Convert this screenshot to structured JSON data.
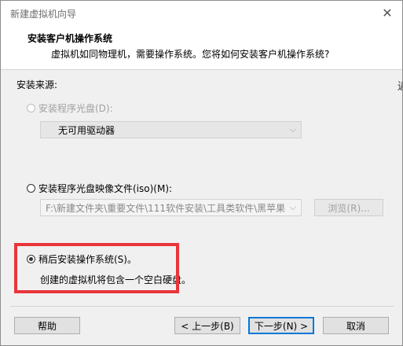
{
  "window": {
    "title": "新建虚拟机向导"
  },
  "header": {
    "title": "安装客户机操作系统",
    "subtitle": "虚拟机如同物理机，需要操作系统。您将如何安装客户机操作系统?"
  },
  "edge_glyph": "近",
  "source": {
    "label": "安装来源:",
    "disc": {
      "label": "安装程序光盘(D):",
      "selected": false,
      "enabled": false,
      "dropdown_value": "无可用驱动器"
    },
    "iso": {
      "label": "安装程序光盘映像文件(iso)(M):",
      "selected": false,
      "path_value": "F:\\新建文件夹\\重要文件\\111软件安装\\工具类软件\\黑苹果",
      "browse_label": "浏览(R)..."
    },
    "later": {
      "label": "稍后安装操作系统(S)。",
      "selected": true,
      "description": "创建的虚拟机将包含一个空白硬盘。"
    }
  },
  "footer": {
    "help": "帮助",
    "back": "< 上一步(B)",
    "next": "下一步(N) >",
    "cancel": "取消"
  },
  "colors": {
    "highlight": "#e8353a",
    "default_button_border": "#0078d7"
  }
}
